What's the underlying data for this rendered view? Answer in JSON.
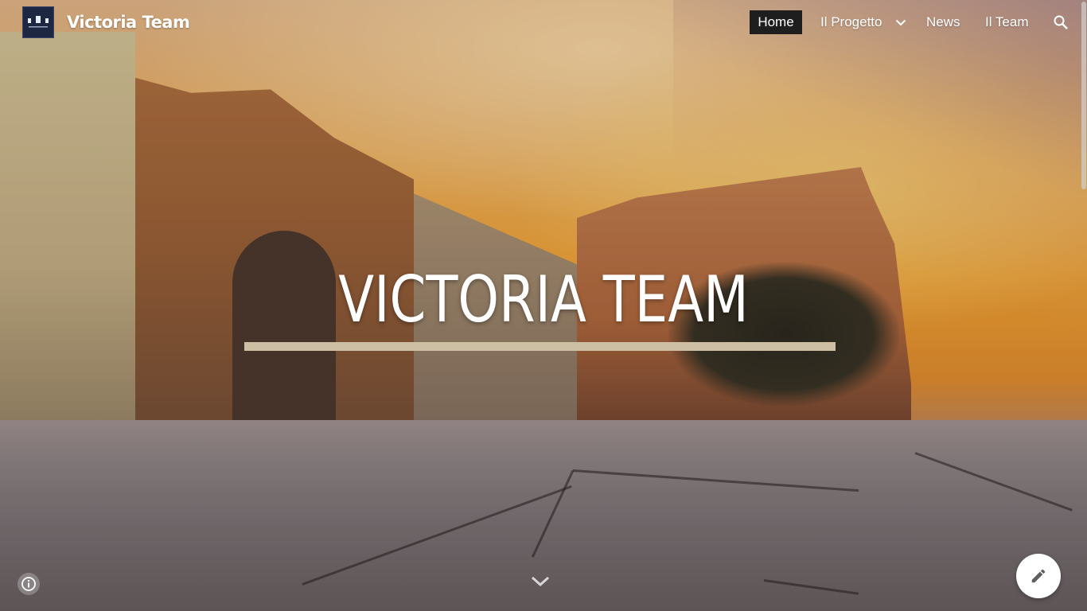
{
  "site": {
    "title": "Victoria Team",
    "logo_icon": "team-logo-icon"
  },
  "nav": {
    "items": [
      {
        "label": "Home",
        "active": true
      },
      {
        "label": "Il Progetto",
        "has_dropdown": true
      },
      {
        "label": "News"
      },
      {
        "label": "Il Team"
      }
    ],
    "dropdown_icon": "chevron-down-icon",
    "search_icon": "search-icon",
    "active_bg": "#1e1e1e"
  },
  "hero": {
    "title": "VICTORIA TEAM",
    "rule_color": "#cdbfa3"
  },
  "controls": {
    "info_icon": "info-icon",
    "scroll_icon": "chevron-down-icon",
    "edit_icon": "pencil-icon"
  }
}
